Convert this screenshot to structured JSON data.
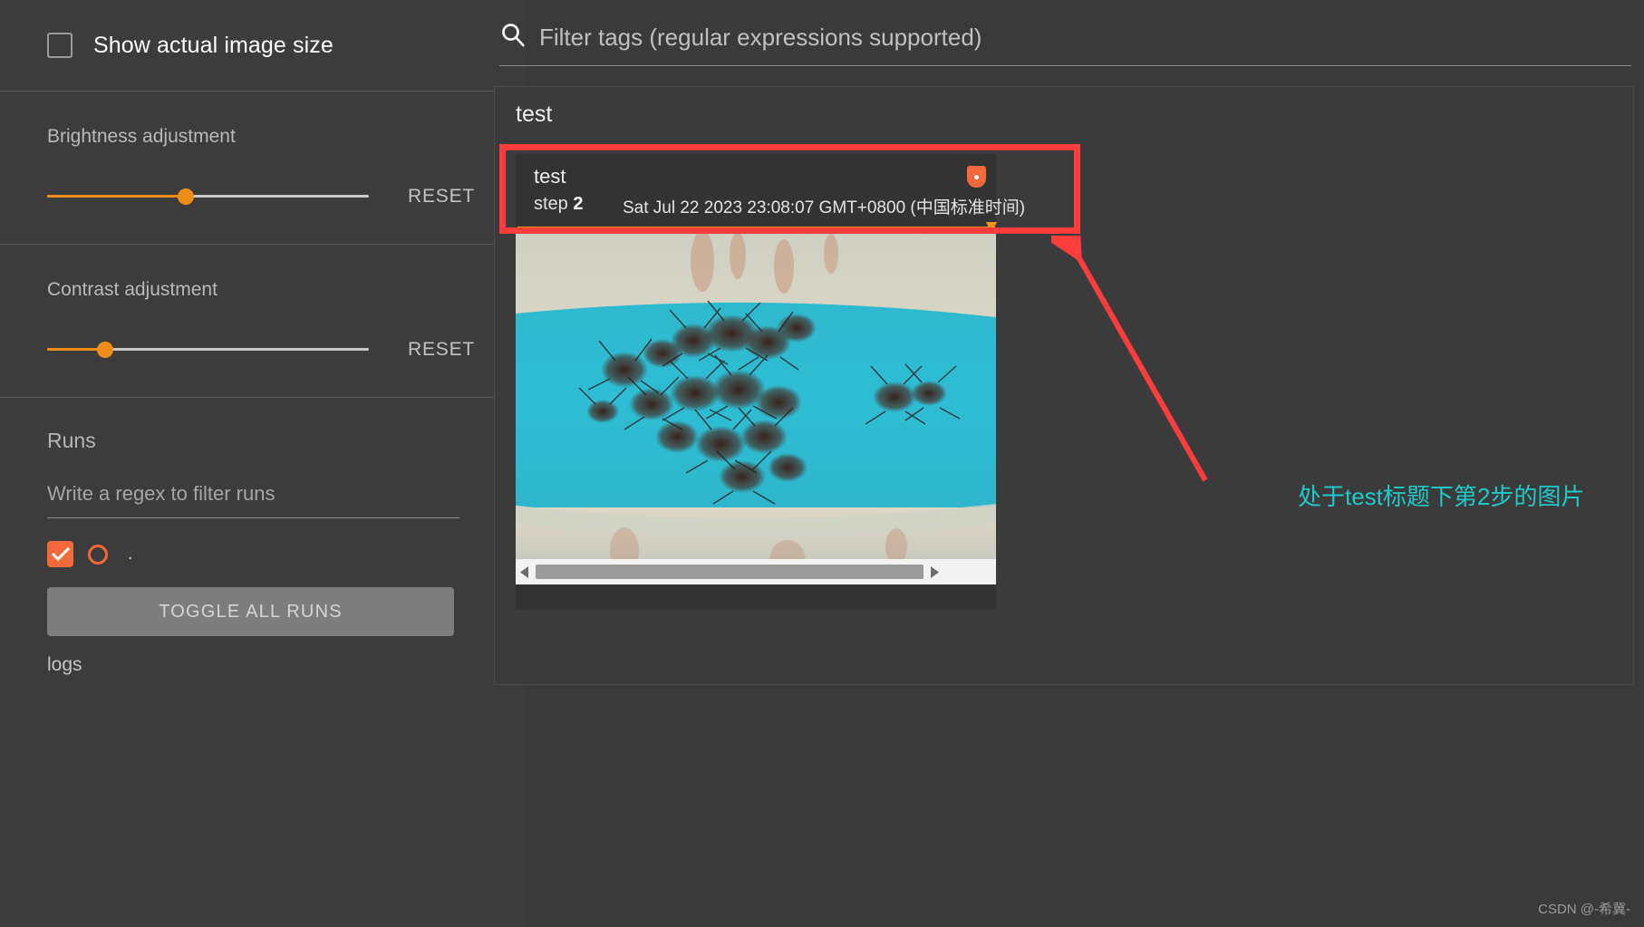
{
  "sidebar": {
    "show_actual_size": {
      "label": "Show actual image size",
      "checked": false
    },
    "brightness": {
      "title": "Brightness adjustment",
      "reset_label": "RESET",
      "value_pct": 43
    },
    "contrast": {
      "title": "Contrast adjustment",
      "reset_label": "RESET",
      "value_pct": 18
    },
    "runs": {
      "title": "Runs",
      "filter_placeholder": "Write a regex to filter runs",
      "run_item": {
        "name": ".",
        "checked": true
      },
      "toggle_all_label": "TOGGLE ALL RUNS",
      "logs_label": "logs"
    }
  },
  "main": {
    "search": {
      "placeholder": "Filter tags (regular expressions supported)",
      "icon": "search-icon",
      "value": ""
    },
    "tag_group": {
      "title": "test"
    },
    "card": {
      "title": "test",
      "step_label": "step",
      "step_value": "2",
      "timestamp": "Sat Jul 22 2023 23:08:07 GMT+0800 (中国标准时间)",
      "pin_icon": "pin-icon",
      "slider_pct": 98,
      "image_alt": "ants-on-blue-container-photo",
      "scrollbar": {
        "left_arrow_icon": "triangle-left-icon",
        "right_arrow_icon": "triangle-right-icon",
        "thumb_pct": 88
      }
    }
  },
  "annotations": {
    "highlight_color": "#fd3c3c",
    "arrow_color": "#fd3c3c",
    "note_text": "处于test标题下第2步的图片",
    "note_color": "#20c9c9"
  },
  "watermark": "CSDN @-希冀-"
}
